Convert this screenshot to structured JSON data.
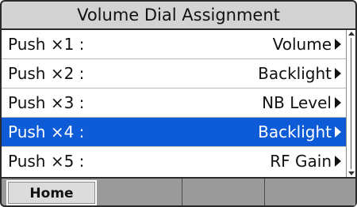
{
  "title": "Volume Dial Assignment",
  "rows": [
    {
      "label": "Push ×1 :",
      "value": "Volume",
      "selected": false
    },
    {
      "label": "Push ×2 :",
      "value": "Backlight",
      "selected": false
    },
    {
      "label": "Push ×3 :",
      "value": "NB Level",
      "selected": false
    },
    {
      "label": "Push ×4 :",
      "value": "Backlight",
      "selected": true
    },
    {
      "label": "Push ×5 :",
      "value": "RF Gain",
      "selected": false
    }
  ],
  "softkeys": [
    {
      "label": "Home"
    },
    {
      "label": ""
    },
    {
      "label": ""
    },
    {
      "label": ""
    }
  ],
  "colors": {
    "title_bg": "#d3d3d3",
    "selected_bg": "#0e5bd8",
    "softkey_bg": "#9a9a9a"
  },
  "icons": {
    "row_arrow": "right-triangle-icon",
    "scroll_up": "scroll-up-arrow-icon",
    "scroll_down": "scroll-down-arrow-icon"
  }
}
